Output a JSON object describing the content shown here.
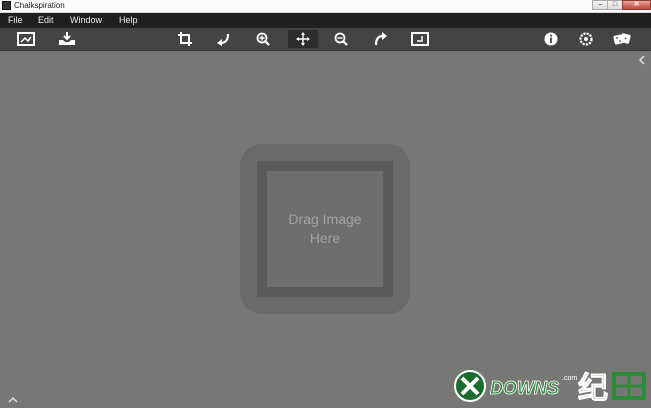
{
  "window": {
    "title": "Chalkspiration",
    "buttons": {
      "minimize": "–",
      "maximize": "□",
      "close": "✕"
    }
  },
  "menu": {
    "items": [
      "File",
      "Edit",
      "Window",
      "Help"
    ]
  },
  "toolbar": {
    "tools": [
      {
        "name": "open-image",
        "icon": "picture-frame-icon"
      },
      {
        "name": "save",
        "icon": "tray-download-icon"
      },
      {
        "name": "crop",
        "icon": "crop-icon"
      },
      {
        "name": "rotate-left",
        "icon": "rotate-left-icon"
      },
      {
        "name": "zoom-in",
        "icon": "zoom-in-icon"
      },
      {
        "name": "pan",
        "icon": "move-arrows-icon",
        "active": true
      },
      {
        "name": "zoom-out",
        "icon": "zoom-out-icon"
      },
      {
        "name": "rotate-right",
        "icon": "rotate-right-icon"
      },
      {
        "name": "fit-screen",
        "icon": "fit-frame-icon"
      },
      {
        "name": "info",
        "icon": "info-icon"
      },
      {
        "name": "settings",
        "icon": "gear-icon"
      },
      {
        "name": "random",
        "icon": "dice-icon"
      }
    ]
  },
  "canvas": {
    "drop_zone": {
      "line1": "Drag Image",
      "line2": "Here"
    },
    "background": "#777776"
  },
  "watermark": {
    "text": "DOWNS",
    "suffix": "纪",
    "com": ".com"
  }
}
